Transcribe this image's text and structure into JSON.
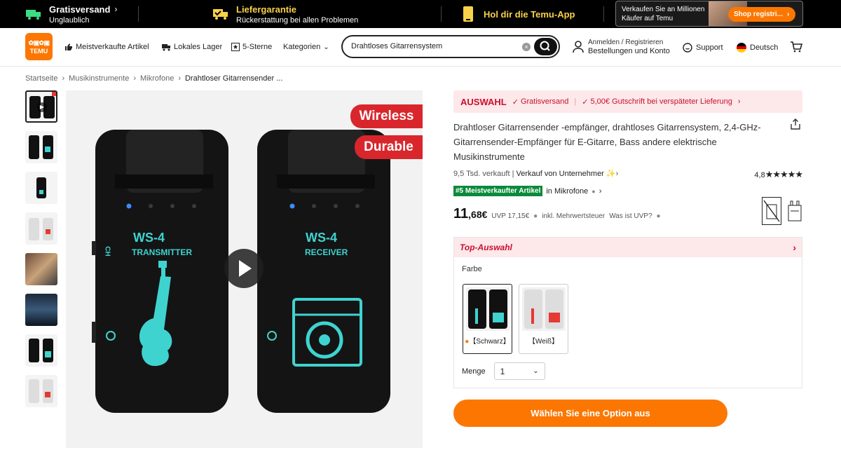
{
  "topbar": {
    "shipping_title": "Gratisversand",
    "shipping_sub": "Unglaublich",
    "guarantee_title": "Liefergarantie",
    "guarantee_sub": "Rückerstattung bei allen Problemen",
    "app_title": "Hol dir die Temu-App",
    "seller_text_1": "Verkaufen Sie an Millionen",
    "seller_text_2": "Käufer auf Temu",
    "seller_button": "Shop registri..."
  },
  "header": {
    "logo_top": "TEMU",
    "nav": [
      "Meistverkaufte Artikel",
      "Lokales Lager",
      "5-Sterne",
      "Kategorien"
    ],
    "search_value": "Drahtloses Gitarrensystem",
    "account_line1": "Anmelden / Registrieren",
    "account_line2": "Bestellungen und Konto",
    "support": "Support",
    "language": "Deutsch"
  },
  "breadcrumb": [
    "Startseite",
    "Musikinstrumente",
    "Mikrofone",
    "Drahtloser Gitarrensender ..."
  ],
  "main_image": {
    "badge_1": "Wireless",
    "badge_2": "Durable",
    "tx_model": "WS-4",
    "tx_label": "TRANSMITTER",
    "rx_model": "WS-4",
    "rx_label": "RECEIVER",
    "ch_label": "CH"
  },
  "product": {
    "promo_label": "AUSWAHL",
    "promo_1": "Gratisversand",
    "promo_2": "5,00€ Gutschrift bei verspäteter Lieferung",
    "title": "Drahtloser Gitarrensender -empfänger, drahtloses Gitarrensystem, 2,4-GHz-Gitarrensender-Empfänger für E-Gitarre, Bass andere elektrische Musikinstrumente",
    "sold": "9,5 Tsd. verkauft",
    "seller": "Verkauf von Unternehmer",
    "rating": "4,8",
    "rank_badge": "#5 Meistverkaufter Artikel",
    "rank_cat": "in Mikrofone",
    "price_main": "11",
    "price_dec": ",68€",
    "uvp": "UVP 17,15€",
    "tax": "inkl. Mehrwertsteuer",
    "uvp_q": "Was ist UVP?",
    "top_selection": "Top-Auswahl",
    "color_label": "Farbe",
    "color_options": [
      "【Schwarz】",
      "【Weiß】"
    ],
    "qty_label": "Menge",
    "qty_value": "1",
    "cta": "Wählen Sie eine Option aus"
  },
  "colors": {
    "accent": "#fb7701",
    "promo_red": "#c8102e",
    "badge_green": "#0a8a3a",
    "device_cyan": "#3fd3d0"
  }
}
